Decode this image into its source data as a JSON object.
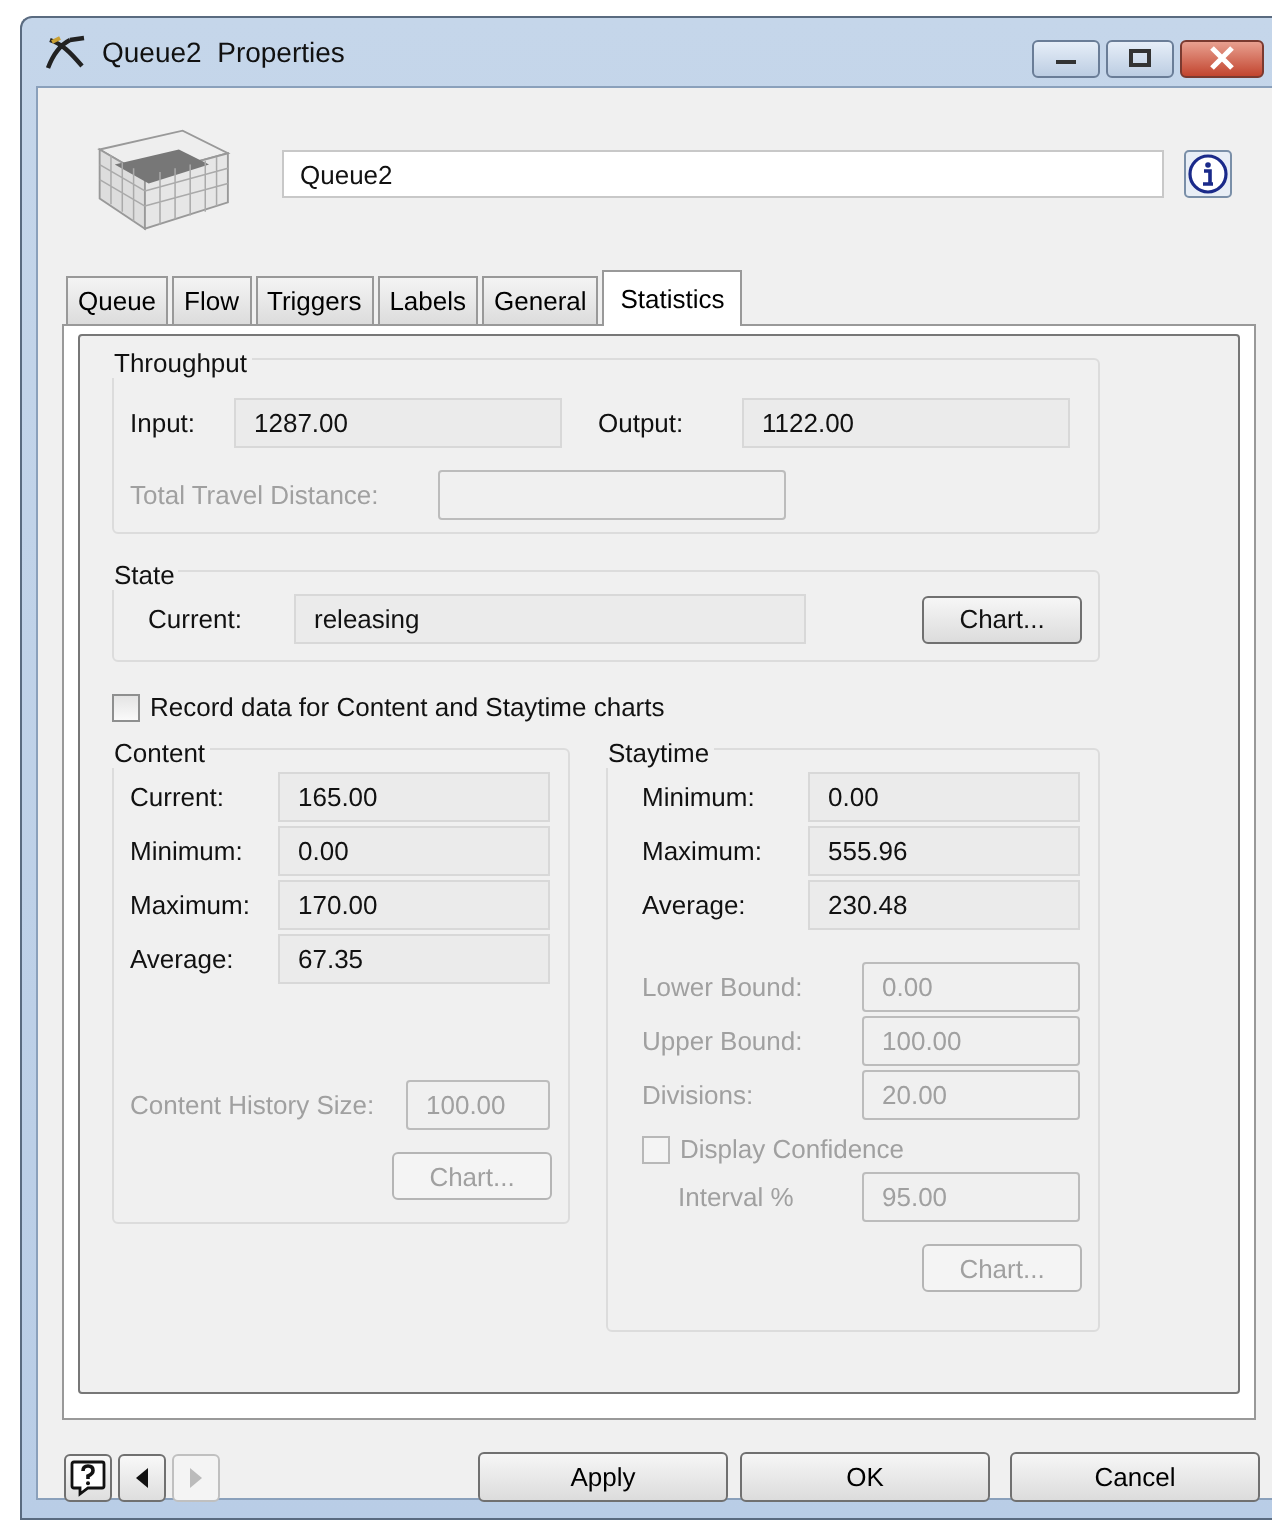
{
  "window": {
    "title": "Queue2  Properties"
  },
  "name_field": {
    "value": "Queue2"
  },
  "tabs": [
    {
      "label": "Queue",
      "selected": false
    },
    {
      "label": "Flow",
      "selected": false
    },
    {
      "label": "Triggers",
      "selected": false
    },
    {
      "label": "Labels",
      "selected": false
    },
    {
      "label": "General",
      "selected": false
    },
    {
      "label": "Statistics",
      "selected": true
    }
  ],
  "throughput": {
    "title": "Throughput",
    "fields": [
      {
        "label": "Input:",
        "value": "1287.00",
        "disabled": false
      },
      {
        "label": "Output:",
        "value": "1122.00",
        "disabled": false
      }
    ],
    "travel": {
      "label": "Total Travel Distance:",
      "disabled": true
    }
  },
  "state": {
    "title": "State",
    "label": "Current:",
    "value": "releasing",
    "disabled": false,
    "button": {
      "label": "Chart...",
      "disabled": false
    }
  },
  "record_checkbox": {
    "label": "Record data for Content and Staytime charts",
    "checked": false,
    "disabled": false
  },
  "content": {
    "title": "Content",
    "rows": [
      {
        "label": "Current:",
        "value": "165.00",
        "disabled": false
      },
      {
        "label": "Minimum:",
        "value": "0.00",
        "disabled": false
      },
      {
        "label": "Maximum:",
        "value": "170.00",
        "disabled": false
      },
      {
        "label": "Average:",
        "value": "67.35",
        "disabled": false
      }
    ],
    "history": {
      "label": "Content History Size:",
      "value": "100.00",
      "disabled": true
    },
    "button": {
      "label": "Chart...",
      "disabled": true
    }
  },
  "staytime": {
    "title": "Staytime",
    "rows": [
      {
        "label": "Minimum:",
        "value": "0.00",
        "disabled": false
      },
      {
        "label": "Maximum:",
        "value": "555.96",
        "disabled": false
      },
      {
        "label": "Average:",
        "value": "230.48",
        "disabled": false
      }
    ],
    "bounds": [
      {
        "label": "Lower Bound:",
        "value": "0.00",
        "disabled": true
      },
      {
        "label": "Upper Bound:",
        "value": "100.00",
        "disabled": true
      },
      {
        "label": "Divisions:",
        "value": "20.00",
        "disabled": true
      }
    ],
    "confidence": {
      "label": "Display Confidence",
      "checked": false,
      "disabled": true
    },
    "interval": {
      "label": "Interval %",
      "value": "95.00",
      "disabled": true
    },
    "button": {
      "label": "Chart...",
      "disabled": true
    }
  },
  "nav": [
    {
      "kind": "help",
      "disabled": false
    },
    {
      "kind": "back",
      "disabled": false
    },
    {
      "kind": "forward",
      "disabled": true
    }
  ],
  "buttons": [
    "Apply",
    "OK",
    "Cancel"
  ]
}
